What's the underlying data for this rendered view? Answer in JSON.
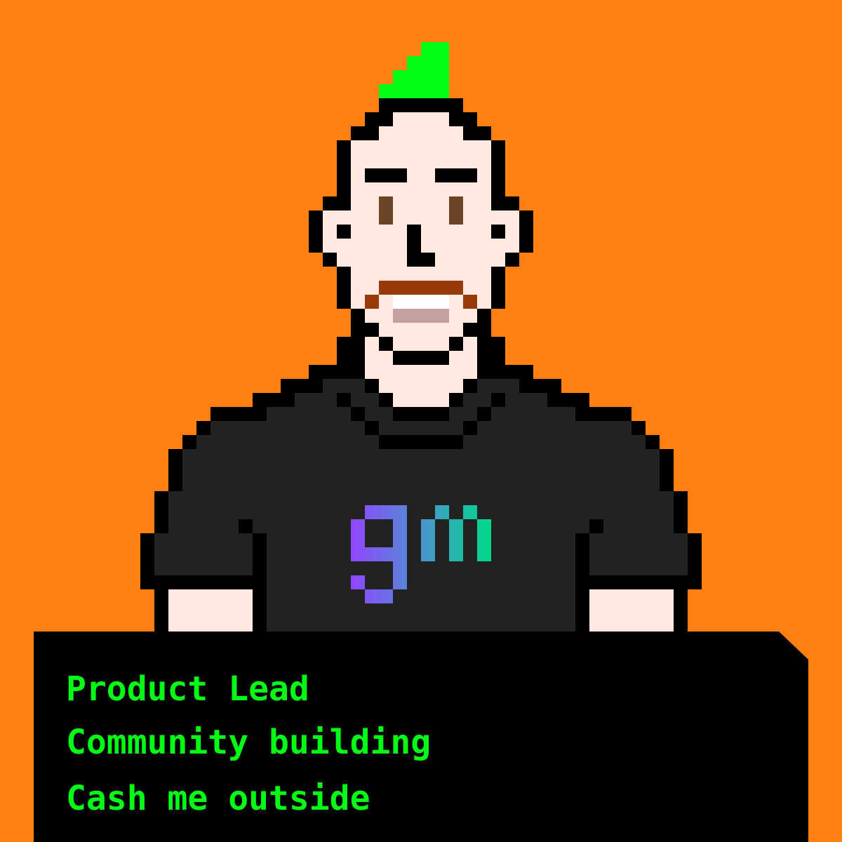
{
  "profile": {
    "lines": [
      "Product Lead",
      "Community building",
      "Cash me outside"
    ]
  },
  "avatar": {
    "shirt_logo": "gm",
    "colors": {
      "background": "#ff8012",
      "mohawk": "#00ff14",
      "skin": "#ffe9e0",
      "outline": "#000000",
      "shirt": "#222222",
      "eyes": "#6b4428",
      "mustache": "#973b0a",
      "teeth": "#ffffff",
      "lip": "#c4a0a0",
      "panel": "#000000",
      "panel_text": "#00ff14"
    }
  }
}
